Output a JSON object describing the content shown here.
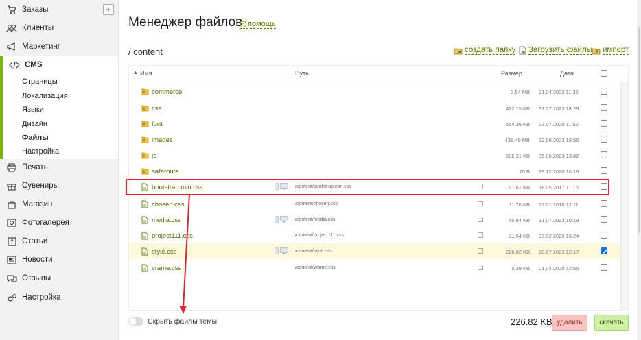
{
  "sidebar": {
    "orders": "Заказы",
    "clients": "Клиенты",
    "marketing": "Маркетинг",
    "cms": "CMS",
    "cms_sub": [
      "Страницы",
      "Локализация",
      "Языки",
      "Дизайн",
      "Файлы",
      "Настройка"
    ],
    "print": "Печать",
    "souvenirs": "Сувениры",
    "shop": "Магазин",
    "gallery": "Фотогалерея",
    "articles": "Статьи",
    "news": "Новости",
    "reviews": "Отзывы",
    "settings": "Настройка",
    "plus": "+"
  },
  "header": {
    "title": "Менеджер файлов",
    "help": "помощь",
    "help_icon": "?"
  },
  "breadcrumb": "/ content",
  "actions": {
    "create_folder": "создать папку",
    "upload": "Загрузить файлы",
    "import": "импорт"
  },
  "table": {
    "columns": {
      "name": "Имя",
      "path": "Путь",
      "size": "Размер",
      "date": "Дата"
    },
    "sort_icon": "▲",
    "rows": [
      {
        "name": "commerce",
        "type": "folder",
        "path": "",
        "size": "2.54 MB",
        "date": "21.04.2022 11:35",
        "checked": false
      },
      {
        "name": "css",
        "type": "folder",
        "path": "",
        "size": "472.15 KB",
        "date": "31.07.2023 18:29",
        "checked": false
      },
      {
        "name": "font",
        "type": "folder",
        "path": "",
        "size": "654.36 KB",
        "date": "23.07.2020 11:52",
        "checked": false
      },
      {
        "name": "images",
        "type": "folder",
        "path": "",
        "size": "438.49 MB",
        "date": "22.06.2023 13:56",
        "checked": false
      },
      {
        "name": "js",
        "type": "folder",
        "path": "",
        "size": "682.31 KB",
        "date": "05.06.2023 13:42",
        "checked": false
      },
      {
        "name": "saferoute",
        "type": "folder",
        "path": "",
        "size": "70 B",
        "date": "29.12.2020 16:16",
        "checked": false
      },
      {
        "name": "bootstrap.min.css",
        "type": "file",
        "path": "/content/bootstrap.min.css",
        "size": "97.61 KB",
        "date": "18.05.2017 11:16",
        "checked": false,
        "devices": true
      },
      {
        "name": "chosen.css",
        "type": "file",
        "path": "/content/chosen.css",
        "size": "11.70 KB",
        "date": "17.01.2018 12:11",
        "checked": false,
        "devices": false
      },
      {
        "name": "media.css",
        "type": "file",
        "path": "/content/media.css",
        "size": "55.84 KB",
        "date": "31.07.2023 10:19",
        "checked": false,
        "devices": true
      },
      {
        "name": "project111.css",
        "type": "file",
        "path": "/content/project111.css",
        "size": "21.54 KB",
        "date": "07.02.2020 16:24",
        "checked": false,
        "devices": false
      },
      {
        "name": "style.css",
        "type": "file",
        "path": "/content/style.css",
        "size": "226.82 KB",
        "date": "28.07.2023 12:17",
        "checked": true,
        "devices": true
      },
      {
        "name": "vrame.css",
        "type": "file",
        "path": "/content/vrame.css",
        "size": "5.39 KB",
        "date": "01.04.2020 12:55",
        "checked": false,
        "devices": false
      }
    ]
  },
  "footer": {
    "hide_theme_files": "Скрыть файлы темы",
    "total": "226.82 KB",
    "delete": "удалить",
    "download": "скачать"
  },
  "colors": {
    "accent": "#7ab800",
    "link": "#4f6b00",
    "highlight_box": "#e8202a",
    "selected_row": "#fdf9da",
    "delete_button": "#f7c4c4",
    "download_button": "#cfeea6"
  }
}
